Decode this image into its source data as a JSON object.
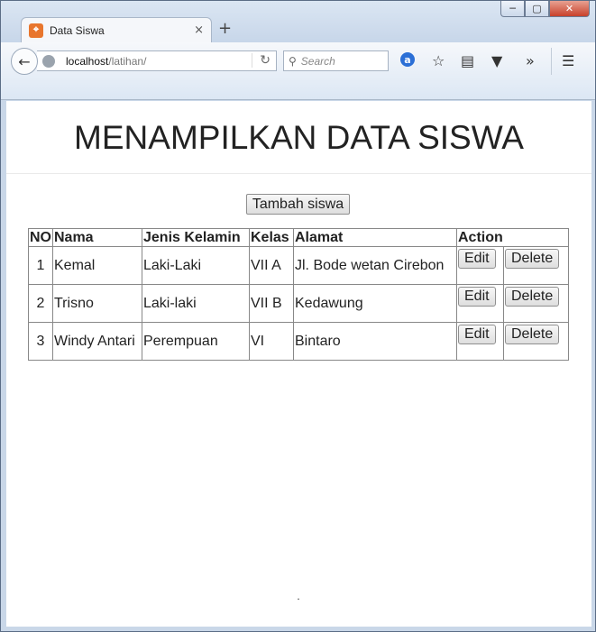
{
  "browser": {
    "tab_title": "Data Siswa",
    "tab_close": "×",
    "new_tab": "+",
    "url_host": "localhost",
    "url_path": "/latihan/",
    "search_placeholder": "Search"
  },
  "page": {
    "title": "MENAMPILKAN DATA SISWA",
    "add_button": "Tambah siswa"
  },
  "table": {
    "headers": [
      "NO",
      "Nama",
      "Jenis Kelamin",
      "Kelas",
      "Alamat",
      "Action"
    ],
    "rows": [
      {
        "no": "1",
        "nama": "Kemal",
        "jenis_kelamin": "Laki-Laki",
        "kelas": "VII A",
        "alamat": "Jl. Bode wetan Cirebon"
      },
      {
        "no": "2",
        "nama": "Trisno",
        "jenis_kelamin": "Laki-laki",
        "kelas": "VII B",
        "alamat": "Kedawung"
      },
      {
        "no": "3",
        "nama": "Windy Antari",
        "jenis_kelamin": "Perempuan",
        "kelas": "VI",
        "alamat": "Bintaro"
      }
    ],
    "edit_label": "Edit",
    "delete_label": "Delete"
  }
}
